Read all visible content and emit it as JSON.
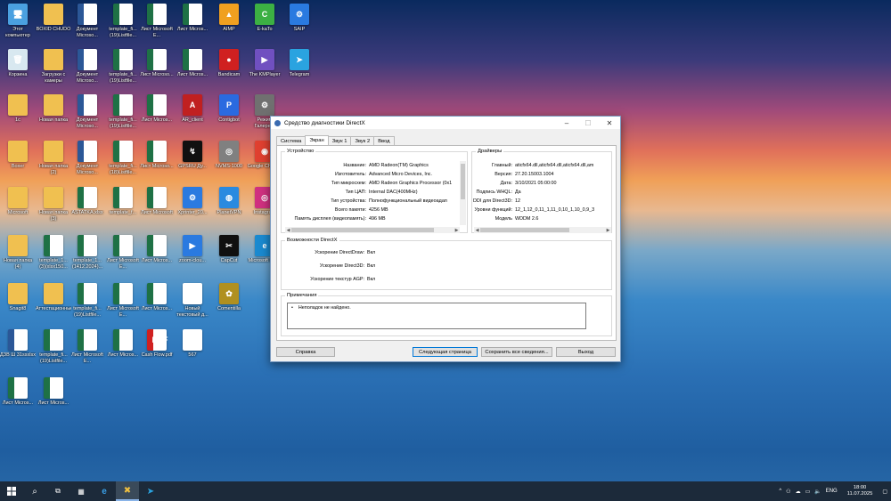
{
  "desktop_icons": [
    {
      "label": "Этот компьютер",
      "glyph": "🖥",
      "kind": "pc",
      "icon": "computer-icon"
    },
    {
      "label": "BOXID CHUDO",
      "glyph": "",
      "kind": "folder",
      "icon": "folder-icon"
    },
    {
      "label": "Документ Microso...",
      "glyph": "W",
      "kind": "word",
      "icon": "word-icon"
    },
    {
      "label": "template_fi... (19)Listfile...",
      "glyph": "X",
      "kind": "excel",
      "icon": "excel-icon"
    },
    {
      "label": "Лист Microsoft E...",
      "glyph": "X",
      "kind": "excel",
      "icon": "excel-icon"
    },
    {
      "label": "Лист Micros...",
      "glyph": "X",
      "kind": "excel",
      "icon": "excel-icon"
    },
    {
      "label": "AIMP",
      "glyph": "▲",
      "kind": "app",
      "color": "#f0a020",
      "icon": "aimp-icon"
    },
    {
      "label": "E-kaTo",
      "glyph": "C",
      "kind": "app",
      "color": "#3cb043",
      "icon": "app-icon"
    },
    {
      "label": "SAIP",
      "glyph": "⚙",
      "kind": "app",
      "color": "#2a7ae0",
      "icon": "app-icon"
    },
    {
      "label": "Корзина",
      "glyph": "🗑",
      "kind": "bin",
      "icon": "recycle-bin-icon"
    },
    {
      "label": "Загрузки с камеры",
      "glyph": "",
      "kind": "folder",
      "icon": "folder-icon"
    },
    {
      "label": "Документ Microso...",
      "glyph": "W",
      "kind": "word",
      "icon": "word-icon"
    },
    {
      "label": "template_fi... (19)Listfile...",
      "glyph": "X",
      "kind": "excel",
      "icon": "excel-icon"
    },
    {
      "label": "Лист Microso...",
      "glyph": "X",
      "kind": "excel",
      "icon": "excel-icon"
    },
    {
      "label": "Лист Micros...",
      "glyph": "X",
      "kind": "excel",
      "icon": "excel-icon"
    },
    {
      "label": "Bandicam",
      "glyph": "●",
      "kind": "app",
      "color": "#d02020",
      "icon": "bandicam-icon"
    },
    {
      "label": "The KMPlayer",
      "glyph": "▶",
      "kind": "app",
      "color": "#7050c0",
      "icon": "kmplayer-icon"
    },
    {
      "label": "Telegram",
      "glyph": "➤",
      "kind": "app",
      "color": "#2aa3e0",
      "icon": "telegram-icon"
    },
    {
      "label": "1с",
      "glyph": "",
      "kind": "folder",
      "icon": "folder-icon"
    },
    {
      "label": "Новая папка",
      "glyph": "",
      "kind": "folder",
      "icon": "folder-icon"
    },
    {
      "label": "Документ Microso...",
      "glyph": "W",
      "kind": "word",
      "icon": "word-icon"
    },
    {
      "label": "template_fi... (19)Listfile...",
      "glyph": "X",
      "kind": "excel",
      "icon": "excel-icon"
    },
    {
      "label": "Лист Micros...",
      "glyph": "X",
      "kind": "excel",
      "icon": "excel-icon"
    },
    {
      "label": "AR_client",
      "glyph": "A",
      "kind": "app",
      "color": "#c02020",
      "icon": "app-icon"
    },
    {
      "label": "Сontigbot",
      "glyph": "P",
      "kind": "app",
      "color": "#2a6ae0",
      "icon": "app-icon"
    },
    {
      "label": "Режим Галере...",
      "glyph": "⚙",
      "kind": "app",
      "color": "#707070",
      "icon": "app-icon"
    },
    {
      "label": "Boxer",
      "glyph": "",
      "kind": "folder",
      "icon": "folder-icon"
    },
    {
      "label": "Новая папка (2)",
      "glyph": "",
      "kind": "folder",
      "icon": "folder-icon"
    },
    {
      "label": "Документ Microso...",
      "glyph": "W",
      "kind": "word",
      "icon": "word-icon"
    },
    {
      "label": "template_fi... (18)Listfile...",
      "glyph": "X",
      "kind": "excel",
      "icon": "excel-icon"
    },
    {
      "label": "Лист Microso...",
      "glyph": "X",
      "kind": "excel",
      "icon": "excel-icon"
    },
    {
      "label": "GPSRU Ду...",
      "glyph": "↯",
      "kind": "app",
      "color": "#101010",
      "icon": "app-icon"
    },
    {
      "label": "NVMS-1000",
      "glyph": "◎",
      "kind": "app",
      "color": "#808080",
      "icon": "app-icon"
    },
    {
      "label": "Google Chrome",
      "glyph": "◉",
      "kind": "app",
      "color": "#e04030",
      "icon": "chrome-icon"
    },
    {
      "label": "Microsoft",
      "glyph": "",
      "kind": "folder",
      "icon": "folder-icon"
    },
    {
      "label": "Новая папка (3)",
      "glyph": "",
      "kind": "folder",
      "icon": "folder-icon"
    },
    {
      "label": "ASTATKA.xlsx",
      "glyph": "X",
      "kind": "excel",
      "icon": "excel-icon"
    },
    {
      "label": "template_f...",
      "glyph": "X",
      "kind": "excel",
      "icon": "excel-icon"
    },
    {
      "label": "Лист Microsoft",
      "glyph": "X",
      "kind": "excel",
      "icon": "excel-icon"
    },
    {
      "label": "Xprinter_20...",
      "glyph": "⚙",
      "kind": "app",
      "color": "#2a7ae0",
      "icon": "app-icon"
    },
    {
      "label": "PlanetVPN",
      "glyph": "◍",
      "kind": "app",
      "color": "#2a8ae0",
      "icon": "vpn-icon"
    },
    {
      "label": "Instagram",
      "glyph": "◎",
      "kind": "app",
      "color": "#d03080",
      "icon": "instagram-icon"
    },
    {
      "label": "Новая папка (4)",
      "glyph": "",
      "kind": "folder",
      "icon": "folder-icon"
    },
    {
      "label": "template_1... (3)(xlsx150...",
      "glyph": "X",
      "kind": "excel",
      "icon": "excel-icon"
    },
    {
      "label": "template_1... (1412.2024)...",
      "glyph": "X",
      "kind": "excel",
      "icon": "excel-icon"
    },
    {
      "label": "Лист Microsoft E...",
      "glyph": "X",
      "kind": "excel",
      "icon": "excel-icon"
    },
    {
      "label": "Лист Micros...",
      "glyph": "X",
      "kind": "excel",
      "icon": "excel-icon"
    },
    {
      "label": "zoom-clou...",
      "glyph": "▶",
      "kind": "app",
      "color": "#2a7ae0",
      "icon": "zoom-icon"
    },
    {
      "label": "CapCut",
      "glyph": "✂",
      "kind": "app",
      "color": "#101010",
      "icon": "capcut-icon"
    },
    {
      "label": "Microsoft Edge",
      "glyph": "e",
      "kind": "app",
      "color": "#1a8ad0",
      "icon": "edge-icon"
    },
    {
      "label": "Snagit8",
      "glyph": "",
      "kind": "folder",
      "icon": "folder-icon"
    },
    {
      "label": "Аттестационные",
      "glyph": "",
      "kind": "folder",
      "icon": "folder-icon"
    },
    {
      "label": "template_fi... (19)Listfile...",
      "glyph": "X",
      "kind": "excel",
      "icon": "excel-icon"
    },
    {
      "label": "Лист Microsoft E...",
      "glyph": "X",
      "kind": "excel",
      "icon": "excel-icon"
    },
    {
      "label": "Лист Micros...",
      "glyph": "X",
      "kind": "excel",
      "icon": "excel-icon"
    },
    {
      "label": "Новый текстовый д...",
      "glyph": "≡",
      "kind": "file",
      "icon": "text-file-icon"
    },
    {
      "label": "Соmentilla",
      "glyph": "✿",
      "kind": "app",
      "color": "#b09020",
      "icon": "app-icon"
    },
    {
      "label": "ДЗВ Ш 31ssxlsx",
      "glyph": "W",
      "kind": "word",
      "icon": "word-icon"
    },
    {
      "label": "template_fi... (19)Listfile...",
      "glyph": "X",
      "kind": "excel",
      "icon": "excel-icon"
    },
    {
      "label": "Лист Microsoft E...",
      "glyph": "X",
      "kind": "excel",
      "icon": "excel-icon"
    },
    {
      "label": "Лист Micros...",
      "glyph": "X",
      "kind": "excel",
      "icon": "excel-icon"
    },
    {
      "label": "Cash Flow.pdf",
      "glyph": "PDF",
      "kind": "pdf",
      "icon": "pdf-icon"
    },
    {
      "label": "567",
      "glyph": "≡",
      "kind": "file",
      "icon": "file-icon"
    },
    {
      "label": "Лист Micros...",
      "glyph": "X",
      "kind": "excel",
      "icon": "excel-icon"
    },
    {
      "label": "Лист Micros...",
      "glyph": "X",
      "kind": "excel",
      "icon": "excel-icon"
    }
  ],
  "window": {
    "title": "Средство диагностики DirectX",
    "tabs": [
      {
        "label": "Система",
        "active": false
      },
      {
        "label": "Экран",
        "active": true
      },
      {
        "label": "Звук 1",
        "active": false
      },
      {
        "label": "Звук 2",
        "active": false
      },
      {
        "label": "Ввод",
        "active": false
      }
    ],
    "device": {
      "title": "Устройство",
      "rows": [
        {
          "k": "Название:",
          "v": "AMD Radeon(TM) Graphics"
        },
        {
          "k": "Изготовитель:",
          "v": "Advanced Micro Devices, Inc."
        },
        {
          "k": "Тип микросхем:",
          "v": "AMD Radeon Graphics Processor (0x1"
        },
        {
          "k": "Тип ЦАП:",
          "v": "Internal DAC(400MHz)"
        },
        {
          "k": "Тип устройства:",
          "v": "Полнофункциональный видеоадап"
        },
        {
          "k": "Всего памяти:",
          "v": "4256 MB"
        },
        {
          "k": "Память дисплея (видеопамять):",
          "v": "496 MB"
        }
      ]
    },
    "drivers": {
      "title": "Драйверы",
      "rows": [
        {
          "k": "Главный:",
          "v": "aticfx64.dll,aticfx64.dll,aticfx64.dll,am"
        },
        {
          "k": "Версия:",
          "v": "27.20.15003.1004"
        },
        {
          "k": "Дата:",
          "v": "3/10/2021 05:00:00"
        },
        {
          "k": "Подпись WHQL:",
          "v": "Да"
        },
        {
          "k": "DDI для Direct3D:",
          "v": "12"
        },
        {
          "k": "Уровни функций:",
          "v": "12_1,12_0,11_1,11_0,10_1,10_0,9_3"
        },
        {
          "k": "Модель",
          "v": "WDDM 2.6"
        }
      ]
    },
    "features": {
      "title": "Возможности DirectX",
      "rows": [
        {
          "k": "Ускорение DirectDraw:",
          "v": "Вкл"
        },
        {
          "k": "Ускорение Direct3D:",
          "v": "Вкл"
        },
        {
          "k": "Ускорение текстур AGP:",
          "v": "Вкл"
        }
      ]
    },
    "notes": {
      "title": "Примечания",
      "items": [
        "Неполадок не найдено."
      ]
    },
    "buttons": {
      "help": "Справка",
      "next": "Следующая страница",
      "save": "Сохранить все сведения...",
      "exit": "Выход"
    }
  },
  "taskbar": {
    "lang": "ENG",
    "time": "18:00",
    "date": "11.07.2025"
  }
}
